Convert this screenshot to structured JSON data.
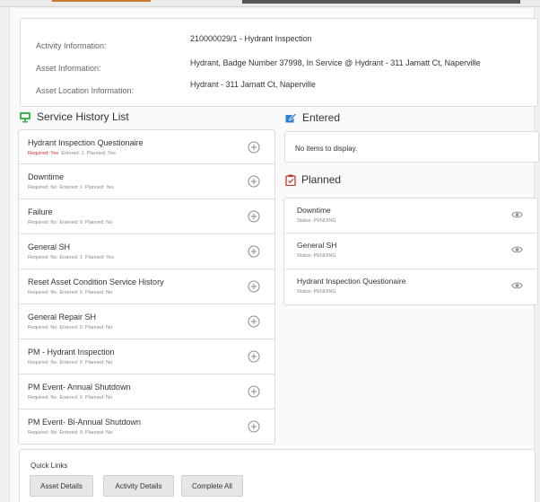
{
  "info": {
    "activity_label": "Activity Information:",
    "activity_value": "210000029/1 - Hydrant Inspection",
    "asset_label": "Asset Information:",
    "asset_value": "Hydrant, Badge Number 37998, In Service @ Hydrant - 311 Jamatt Ct, Naperville",
    "location_label": "Asset Location Information:",
    "location_value": "Hydrant - 311 Jamatt Ct, Naperville"
  },
  "service_history": {
    "title": "Service History List",
    "icon": "monitor-icon",
    "icon_color": "#3bb54a",
    "items": [
      {
        "title": "Hydrant Inspection Questionaire",
        "required": "Required: Yes",
        "entered": "Entered: 1",
        "planned": "Planned: Yes"
      },
      {
        "title": "Downtime",
        "required": "Required: No",
        "entered": "Entered: 1",
        "planned": "Planned: Yes"
      },
      {
        "title": "Failure",
        "required": "Required: No",
        "entered": "Entered: 0",
        "planned": "Planned: No"
      },
      {
        "title": "General SH",
        "required": "Required: No",
        "entered": "Entered: 1",
        "planned": "Planned: Yes"
      },
      {
        "title": "Reset Asset Condition Service History",
        "required": "Required: No",
        "entered": "Entered: 0",
        "planned": "Planned: No"
      },
      {
        "title": "General Repair SH",
        "required": "Required: No",
        "entered": "Entered: 0",
        "planned": "Planned: No"
      },
      {
        "title": "PM - Hydrant Inspection",
        "required": "Required: No",
        "entered": "Entered: 0",
        "planned": "Planned: No"
      },
      {
        "title": "PM Event- Annual Shutdown",
        "required": "Required: No",
        "entered": "Entered: 0",
        "planned": "Planned: No"
      },
      {
        "title": "PM Event- Bi-Annual Shutdown",
        "required": "Required: No",
        "entered": "Entered: 0",
        "planned": "Planned: No"
      }
    ]
  },
  "entered": {
    "title": "Entered",
    "icon": "edit-icon",
    "icon_color": "#2f7fd4",
    "empty_text": "No items to display."
  },
  "planned": {
    "title": "Planned",
    "icon": "clipboard-icon",
    "icon_color": "#c0392b",
    "items": [
      {
        "title": "Downtime",
        "status": "Status :PENDING"
      },
      {
        "title": "General SH",
        "status": "Status :PENDING"
      },
      {
        "title": "Hydrant Inspection Questionaire",
        "status": "Status :PENDING"
      }
    ]
  },
  "quick_links": {
    "title": "Quick Links",
    "buttons": [
      "Asset Details",
      "Activity Details",
      "Complete All"
    ]
  },
  "colors": {
    "required_yes": "#e02b2b",
    "border": "#dcdcdc",
    "button_bg": "#e6e6e6"
  }
}
